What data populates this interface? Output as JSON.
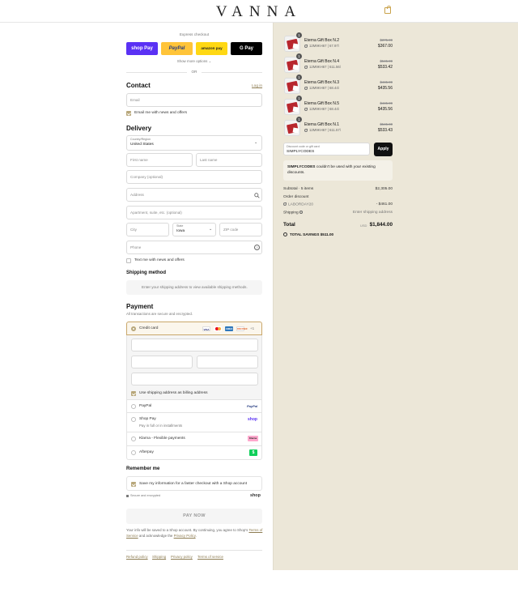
{
  "brand": "VANNA",
  "express": {
    "label": "Express checkout",
    "shop_pay": "shop Pay",
    "paypal": "PayPal",
    "amazon_pay": "amazon pay",
    "google_pay": "G Pay",
    "more": "Show more options ⌄",
    "or": "OR"
  },
  "contact": {
    "title": "Contact",
    "login": "Log in",
    "email_placeholder": "Email",
    "news_label": "Email me with news and offers"
  },
  "delivery": {
    "title": "Delivery",
    "country_label": "Country/Region",
    "country_value": "United States",
    "first_name": "First name",
    "last_name": "Last name",
    "company": "Company (optional)",
    "address": "Address",
    "apartment": "Apartment, suite, etc. (optional)",
    "city": "City",
    "state_label": "State",
    "state_value": "Iowa",
    "zip": "ZIP code",
    "phone": "Phone",
    "text_label": "Text me with news and offers"
  },
  "shipping_method": {
    "title": "Shipping method",
    "message": "Enter your shipping address to view available shipping methods."
  },
  "payment": {
    "title": "Payment",
    "subtitle": "All transactions are secure and encrypted.",
    "credit_card": "Credit card",
    "cards": [
      "VISA",
      "MC",
      "AMEX",
      "DISCOVER"
    ],
    "more_cards": "+1",
    "billing_label": "Use shipping address as billing address",
    "options": [
      {
        "label": "PayPal",
        "sub": "",
        "badge": "PayPal"
      },
      {
        "label": "Shop Pay",
        "sub": "Pay in full or in installments",
        "badge": "shop"
      },
      {
        "label": "Klarna - Flexible payments",
        "sub": "",
        "badge": "Klarna"
      },
      {
        "label": "Afterpay",
        "sub": "",
        "badge": "$"
      }
    ]
  },
  "remember": {
    "title": "Remember me",
    "save_label": "Save my information for a faster checkout with a Shop account",
    "secure": "Secure and encrypted",
    "shop": "shop"
  },
  "pay_now": "PAY NOW",
  "legal": {
    "line1": "Your info will be saved to a Shop account. By continuing, you agree to Shop's",
    "terms": "Terms of Service",
    "middle": "and acknowledge the",
    "privacy": "Privacy Policy",
    "end": "."
  },
  "footer_links": [
    "Refund policy",
    "Shipping",
    "Privacy policy",
    "Terms of service"
  ],
  "summary": {
    "items": [
      {
        "name": "Eterna Gift Box N.2",
        "code": "12M9KH67 | 67.97\\",
        "old": "$375.99",
        "price": "$367.00",
        "qty": "1"
      },
      {
        "name": "Eterna Gift Box N.4",
        "code": "12M9KH67 | 611.56\\",
        "old": "$545.99",
        "price": "$533.42",
        "qty": "1"
      },
      {
        "name": "Eterna Gift Box N.3",
        "code": "12M9KH67 | 68.44\\",
        "old": "$445.99",
        "price": "$435.56",
        "qty": "1"
      },
      {
        "name": "Eterna Gift Box N.5",
        "code": "12M9KH67 | 68.44\\",
        "old": "$445.99",
        "price": "$435.56",
        "qty": "1"
      },
      {
        "name": "Eterna Gift Box N.1",
        "code": "12M9KH67 | 611.57\\",
        "old": "$545.00",
        "price": "$533.43",
        "qty": "1"
      }
    ],
    "discount_label": "Discount code or gift card",
    "discount_value": "SIMPLYCODES",
    "apply": "Apply",
    "error_code": "SIMPLYCODES",
    "error_text": "couldn't be used with your existing",
    "error_text2": "discounts.",
    "subtotal_label": "Subtotal · 5 items",
    "subtotal_value": "$2,305.00",
    "order_discount_label": "Order discount",
    "discount_code": "LABORDAY20",
    "discount_amount": "- $461.00",
    "shipping_label": "Shipping",
    "shipping_value": "Enter shipping address",
    "total_label": "Total",
    "currency": "USD",
    "total_value": "$1,844.00",
    "savings_label": "TOTAL SAVINGS",
    "savings_value": "$511.00"
  }
}
